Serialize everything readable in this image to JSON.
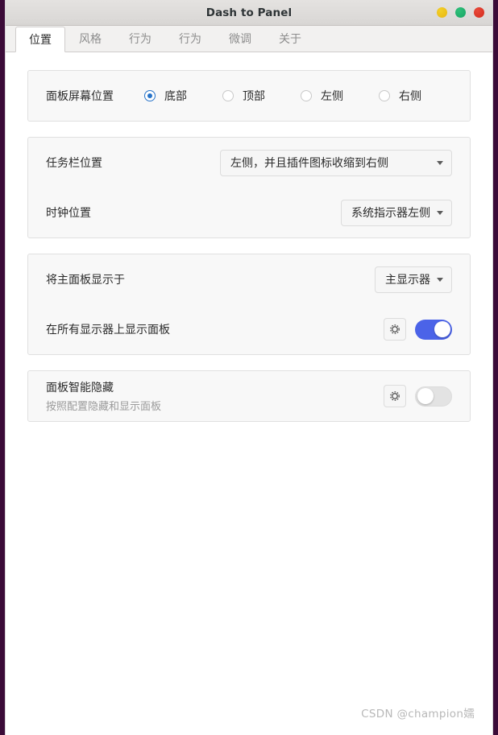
{
  "window": {
    "title": "Dash to Panel",
    "buttons": [
      {
        "name": "minimize-button",
        "color": "#e9b711"
      },
      {
        "name": "maximize-button",
        "color": "#16a463"
      },
      {
        "name": "close-button",
        "color": "#d32b1c"
      }
    ]
  },
  "tabs": [
    {
      "label": "位置",
      "active": true
    },
    {
      "label": "风格",
      "active": false
    },
    {
      "label": "行为",
      "active": false
    },
    {
      "label": "行为",
      "active": false
    },
    {
      "label": "微调",
      "active": false
    },
    {
      "label": "关于",
      "active": false
    }
  ],
  "cards": {
    "screen_position": {
      "label": "面板屏幕位置",
      "options": [
        {
          "label": "底部",
          "selected": true
        },
        {
          "label": "顶部",
          "selected": false
        },
        {
          "label": "左侧",
          "selected": false
        },
        {
          "label": "右侧",
          "selected": false
        }
      ]
    },
    "taskbar": {
      "position_label": "任务栏位置",
      "position_value": "左侧，并且插件图标收缩到右侧",
      "clock_label": "时钟位置",
      "clock_value": "系统指示器左侧"
    },
    "monitors": {
      "primary_label": "将主面板显示于",
      "primary_value": "主显示器",
      "all_monitors_label": "在所有显示器上显示面板",
      "all_monitors_enabled": true
    },
    "intellihide": {
      "label": "面板智能隐藏",
      "description": "按照配置隐藏和显示面板",
      "enabled": false
    }
  },
  "icons": {
    "gear": "gear-icon",
    "caret": "chevron-down-icon"
  },
  "watermark": "CSDN @champion嬬",
  "colors": {
    "accent_radio": "#2672c8",
    "accent_toggle": "#4b63e8",
    "card_bg": "#f8f8f8",
    "desktop": "#3b0b38"
  }
}
